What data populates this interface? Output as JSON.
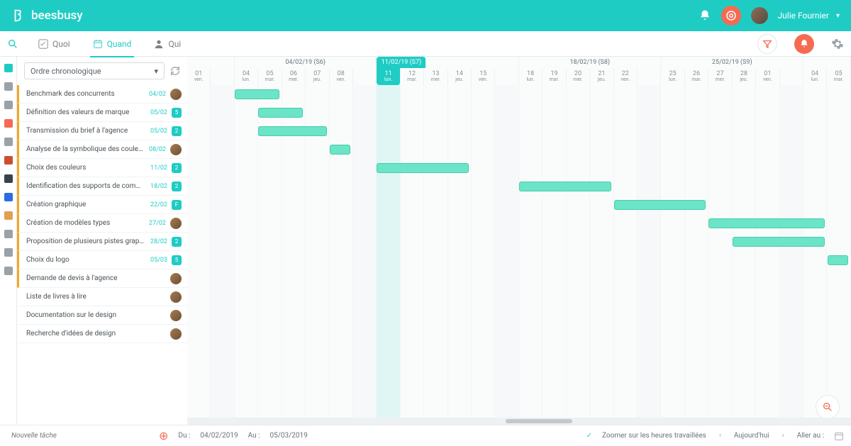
{
  "brand": "beesbusy",
  "user": {
    "name": "Julie Fournier"
  },
  "tabs": {
    "quoi": {
      "label": "Quoi"
    },
    "quand": {
      "label": "Quand"
    },
    "qui": {
      "label": "Qui"
    }
  },
  "sort": {
    "label": "Ordre chronologique"
  },
  "tasks": [
    {
      "name": "Benchmark des concurrents",
      "date": "04/02",
      "badge": null,
      "avatar": true,
      "orange": true
    },
    {
      "name": "Définition des valeurs de marque",
      "date": "05/02",
      "badge": "5",
      "avatar": false,
      "orange": true
    },
    {
      "name": "Transmission du brief à l'agence",
      "date": "05/02",
      "badge": "2",
      "avatar": false,
      "orange": true
    },
    {
      "name": "Analyse de la symbolique des couleurs",
      "date": "08/02",
      "badge": null,
      "avatar": true,
      "orange": true
    },
    {
      "name": "Choix des couleurs",
      "date": "11/02",
      "badge": "2",
      "avatar": false,
      "orange": true
    },
    {
      "name": "Identification des supports de commun...",
      "date": "18/02",
      "badge": "2",
      "avatar": false,
      "orange": true
    },
    {
      "name": "Création graphique",
      "date": "22/02",
      "badge": "F",
      "avatar": false,
      "orange": true
    },
    {
      "name": "Création de modèles types",
      "date": "27/02",
      "badge": null,
      "avatar": true,
      "orange": true
    },
    {
      "name": "Proposition de plusieurs pistes graphiq...",
      "date": "28/02",
      "badge": "2",
      "avatar": false,
      "orange": true
    },
    {
      "name": "Choix du logo",
      "date": "05/03",
      "badge": "5",
      "avatar": false,
      "orange": true
    },
    {
      "name": "Demande de devis à l'agence",
      "date": "",
      "badge": null,
      "avatar": true,
      "orange": true
    },
    {
      "name": "Liste de livres à lire",
      "date": "",
      "badge": null,
      "avatar": true,
      "orange": false
    },
    {
      "name": "Documentation sur le design",
      "date": "",
      "badge": null,
      "avatar": true,
      "orange": false
    },
    {
      "name": "Recherche d'idées de design",
      "date": "",
      "badge": null,
      "avatar": true,
      "orange": false
    }
  ],
  "weeks": [
    {
      "label": "04/02/19 (S6)",
      "current": false
    },
    {
      "label": "11/02/19 (S7)",
      "current": true
    },
    {
      "label": "18/02/19 (S8)",
      "current": false
    },
    {
      "label": "25/02/19 (S9)",
      "current": false
    }
  ],
  "days": [
    {
      "num": "01",
      "name": "ven."
    },
    {
      "num": "",
      "name": ""
    },
    {
      "num": "04",
      "name": "lun."
    },
    {
      "num": "05",
      "name": "mar."
    },
    {
      "num": "06",
      "name": "mer."
    },
    {
      "num": "07",
      "name": "jeu."
    },
    {
      "num": "08",
      "name": "ven."
    },
    {
      "num": "",
      "name": ""
    },
    {
      "num": "11",
      "name": "lun."
    },
    {
      "num": "12",
      "name": "mar."
    },
    {
      "num": "13",
      "name": "mer."
    },
    {
      "num": "14",
      "name": "jeu."
    },
    {
      "num": "15",
      "name": "ven."
    },
    {
      "num": "",
      "name": ""
    },
    {
      "num": "18",
      "name": "lun."
    },
    {
      "num": "19",
      "name": "mar."
    },
    {
      "num": "20",
      "name": "mer."
    },
    {
      "num": "21",
      "name": "jeu."
    },
    {
      "num": "22",
      "name": "ven."
    },
    {
      "num": "",
      "name": ""
    },
    {
      "num": "25",
      "name": "lun."
    },
    {
      "num": "26",
      "name": "mar."
    },
    {
      "num": "27",
      "name": "mer."
    },
    {
      "num": "28",
      "name": "jeu."
    },
    {
      "num": "01",
      "name": "ven."
    },
    {
      "num": "",
      "name": ""
    },
    {
      "num": "04",
      "name": "lun."
    },
    {
      "num": "05",
      "name": "mar."
    }
  ],
  "bars": [
    {
      "row": 0,
      "startCol": 2,
      "span": 2
    },
    {
      "row": 1,
      "startCol": 3,
      "span": 2
    },
    {
      "row": 2,
      "startCol": 3,
      "span": 3
    },
    {
      "row": 3,
      "startCol": 6,
      "span": 1
    },
    {
      "row": 4,
      "startCol": 8,
      "span": 4
    },
    {
      "row": 5,
      "startCol": 14,
      "span": 4
    },
    {
      "row": 6,
      "startCol": 18,
      "span": 4
    },
    {
      "row": 7,
      "startCol": 22,
      "span": 5
    },
    {
      "row": 8,
      "startCol": 23,
      "span": 4
    },
    {
      "row": 9,
      "startCol": 27,
      "span": 1
    }
  ],
  "footer": {
    "newTaskPlaceholder": "Nouvelle tâche",
    "duLabel": "Du :",
    "duValue": "04/02/2019",
    "auLabel": "Au :",
    "auValue": "05/03/2019",
    "zoomLabel": "Zoomer sur les heures travaillées",
    "todayLabel": "Aujourd'hui",
    "gotoLabel": "Aller au :"
  },
  "railColors": [
    "#1fccc4",
    "#9aa1a7",
    "#9aa1a7",
    "#f56b52",
    "#9aa1a7",
    "#c94f32",
    "#3a4248",
    "#2b6de0",
    "#e0a050",
    "#9aa1a7",
    "#9aa1a7",
    "#9aa1a7"
  ]
}
